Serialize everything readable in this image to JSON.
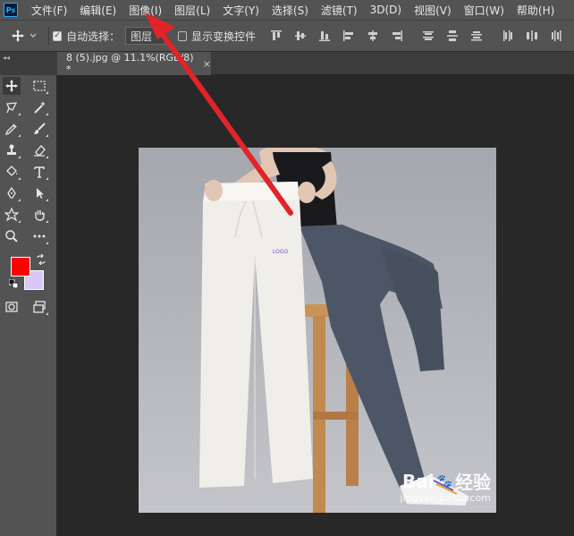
{
  "app": {
    "logo_text": "Ps"
  },
  "menu": {
    "items": [
      "文件(F)",
      "编辑(E)",
      "图像(I)",
      "图层(L)",
      "文字(Y)",
      "选择(S)",
      "滤镜(T)",
      "3D(D)",
      "视图(V)",
      "窗口(W)",
      "帮助(H)"
    ]
  },
  "options": {
    "auto_select_label": "自动选择：",
    "auto_select_checked": true,
    "target_value": "图层",
    "show_transform_label": "显示变换控件",
    "show_transform_checked": false,
    "checkmark": "✓"
  },
  "document": {
    "tab_title": "8 (5).jpg @ 11.1%(RGB/8) *",
    "close_glyph": "×"
  },
  "colors": {
    "foreground": "#ff0000",
    "background": "#d9c8f5",
    "annotation_arrow": "#e0242a"
  },
  "tools": [
    "move-tool",
    "rectangular-marquee-tool",
    "lasso-tool",
    "magic-wand-tool",
    "eyedropper-tool",
    "brush-tool",
    "clone-stamp-tool",
    "eraser-tool",
    "paint-bucket-tool",
    "type-tool",
    "pen-tool",
    "path-selection-tool",
    "custom-shape-tool",
    "hand-tool",
    "zoom-tool",
    "more-tools"
  ],
  "watermark": {
    "brand": "Bai",
    "brand_suffix": "经验",
    "paw": "🐾",
    "du_glyph": "du",
    "url": "jingyan.baidu.com"
  }
}
